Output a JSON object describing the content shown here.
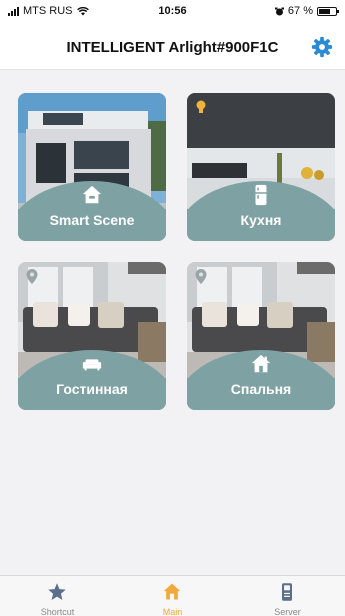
{
  "status_bar": {
    "carrier": "MTS RUS",
    "time": "10:56",
    "battery": "67 %"
  },
  "header": {
    "title": "INTELLIGENT Arlight#900F1C",
    "settings_icon": "gear-icon"
  },
  "tiles": [
    {
      "label": "Smart Scene",
      "icon": "home-icon"
    },
    {
      "label": "Кухня",
      "icon": "fridge-icon"
    },
    {
      "label": "Гостинная",
      "icon": "sofa-icon"
    },
    {
      "label": "Спальня",
      "icon": "house-icon"
    }
  ],
  "tabbar": {
    "tabs": [
      {
        "label": "Shortcut",
        "icon": "star-icon"
      },
      {
        "label": "Main",
        "icon": "home-icon",
        "active": true
      },
      {
        "label": "Server",
        "icon": "device-icon"
      }
    ]
  },
  "colors": {
    "accent": "#2a8ad4",
    "tile_overlay": "#7ea1a3",
    "active_tab": "#f2a93b",
    "inactive_tab": "#8a8a8a"
  }
}
